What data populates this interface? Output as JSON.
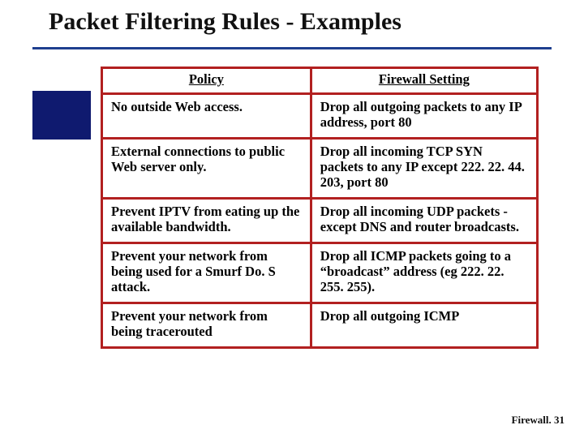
{
  "title": "Packet Filtering Rules - Examples",
  "table": {
    "headers": {
      "policy": "Policy",
      "setting": "Firewall Setting"
    },
    "rows": [
      {
        "policy": "No outside Web access.",
        "setting": "Drop all outgoing packets to any IP address, port 80"
      },
      {
        "policy": "External connections to public Web server only.",
        "setting": "Drop all incoming TCP SYN packets to any IP except 222. 22. 44. 203, port 80"
      },
      {
        "policy": "Prevent IPTV from eating up the available bandwidth.",
        "setting": "Drop all incoming UDP packets - except DNS and router broadcasts."
      },
      {
        "policy": "Prevent your network from being used for a Smurf Do. S attack.",
        "setting": "Drop all ICMP packets going to a “broadcast” address (eg 222. 22. 255. 255)."
      },
      {
        "policy": "Prevent your network from being tracerouted",
        "setting": "Drop all outgoing ICMP"
      }
    ]
  },
  "footer": "Firewall. 31"
}
